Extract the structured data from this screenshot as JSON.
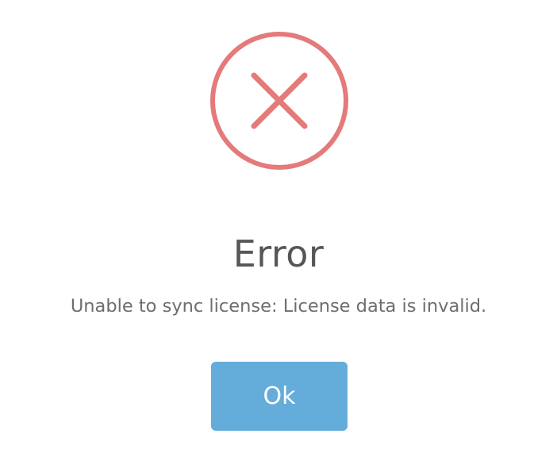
{
  "dialog": {
    "icon": "error-x-circle-icon",
    "title": "Error",
    "message": "Unable to sync license: License data is invalid.",
    "ok_label": "Ok"
  },
  "colors": {
    "error_accent": "#e47a7a",
    "button_bg": "#64acd9",
    "title_text": "#565656",
    "message_text": "#6e6e6e"
  }
}
